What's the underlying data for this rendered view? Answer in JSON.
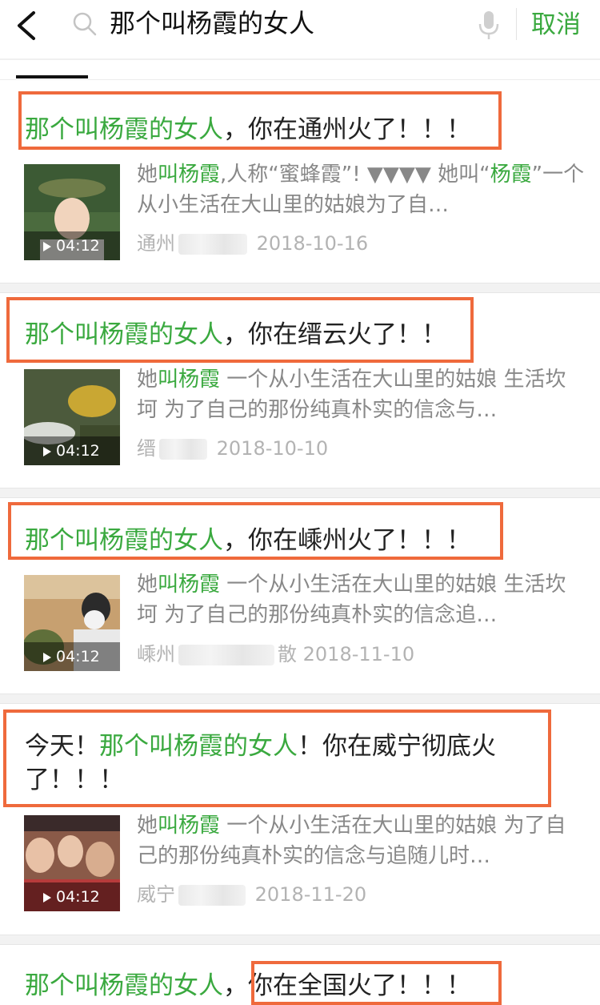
{
  "search": {
    "query": "那个叫杨霞的女人",
    "cancel_label": "取消"
  },
  "results": [
    {
      "title_pre": "",
      "title_hl": "那个叫杨霞的女人",
      "title_post": "，你在通州火了！！！",
      "desc_pre": "她",
      "desc_hl": "叫杨霞",
      "desc_mid": ",人称“蜜蜂霞”! ▼▼▼▼ 她叫“",
      "desc_hl2": "杨霞",
      "desc_post": "”一个从小生活在大山里的姑娘为了自…",
      "duration": "04:12",
      "source": "通州",
      "date": "2018-10-16"
    },
    {
      "title_pre": "",
      "title_hl": "那个叫杨霞的女人",
      "title_post": "，你在缙云火了！！",
      "desc_pre": "她",
      "desc_hl": "叫杨霞",
      "desc_post": " 一个从小生活在大山里的姑娘 生活坎坷 为了自己的那份纯真朴实的信念与…",
      "duration": "04:12",
      "source": "缙",
      "date": "2018-10-10"
    },
    {
      "title_pre": "",
      "title_hl": "那个叫杨霞的女人",
      "title_post": "，你在嵊州火了！！！",
      "desc_pre": "她",
      "desc_hl": "叫杨霞",
      "desc_post": " 一个从小生活在大山里的姑娘 生活坎坷 为了自己的那份纯真朴实的信念追…",
      "duration": "04:12",
      "source": "嵊州",
      "source_tail": "散",
      "date": "2018-11-10"
    },
    {
      "title_pre": "今天！",
      "title_hl": "那个叫杨霞的女人",
      "title_post": "！你在威宁彻底火了！！！",
      "desc_pre": "她",
      "desc_hl": "叫杨霞",
      "desc_post": " 一个从小生活在大山里的姑娘 为了自己的那份纯真朴实的信念与追随儿时…",
      "duration": "04:12",
      "source": "威宁",
      "date": "2018-11-20"
    },
    {
      "title_hl": "那个叫杨霞的女人",
      "title_comma": "，",
      "title_boxed": "你在全国火了！！！"
    }
  ]
}
